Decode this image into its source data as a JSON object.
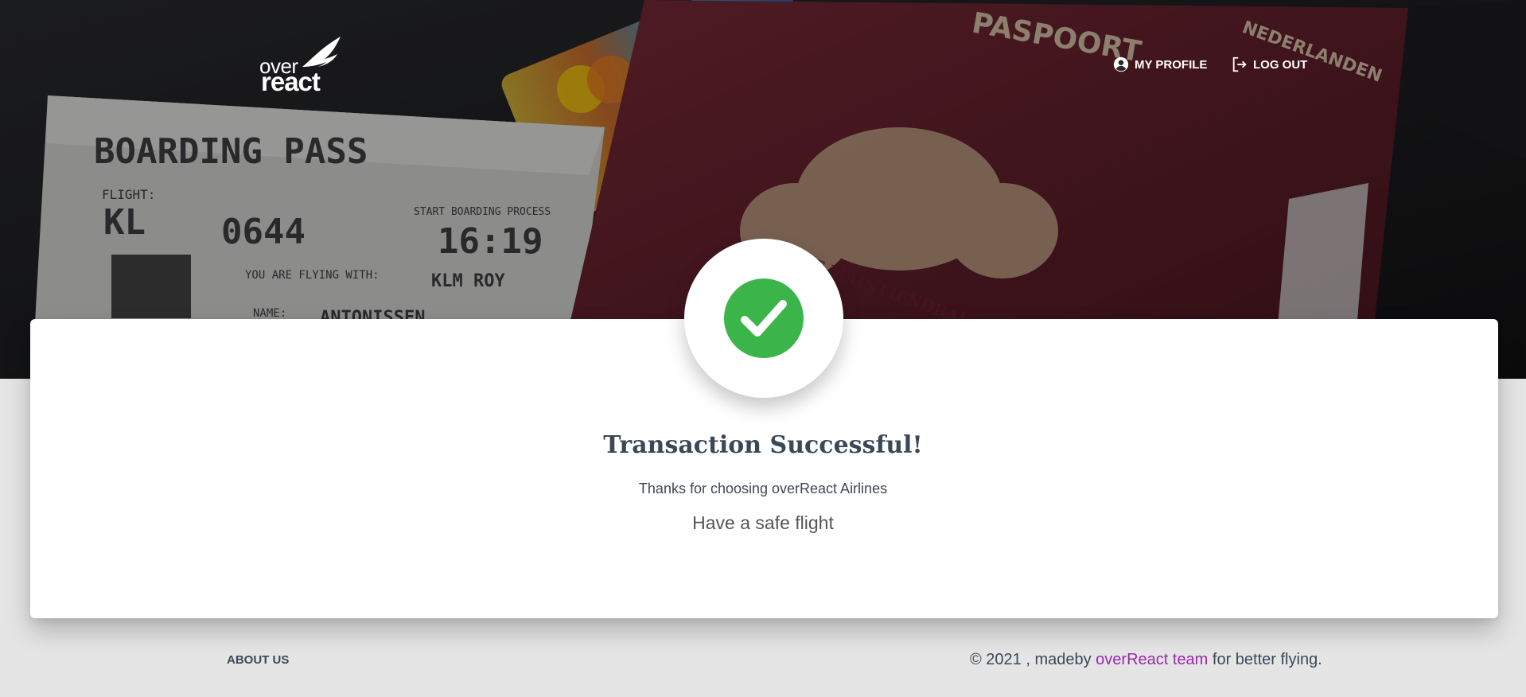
{
  "brand": {
    "logo_top": "over",
    "logo_bottom": "react"
  },
  "header": {
    "nav": [
      {
        "label": "MY PROFILE",
        "icon": "account-circle-icon"
      },
      {
        "label": "LOG OUT",
        "icon": "logout-icon"
      }
    ]
  },
  "hero": {
    "boarding_pass": {
      "heading": "BOARDING PASS",
      "flight_label": "FLIGHT:",
      "flight": "KL",
      "flight_number": "0644",
      "start_label": "START BOARDING PROCESS",
      "time": "16:19",
      "flying_with_label": "YOU ARE FLYING WITH:",
      "carrier": "KLM ROY",
      "name_label": "NAME:",
      "name": "ANTONISSEN"
    },
    "passport": {
      "text": "PASPOORT",
      "country": "NEDERLANDEN",
      "motto": "JE MAINTIENDRAI"
    }
  },
  "status": {
    "icon": "check-circle-icon",
    "title": "Transaction Successful!",
    "thanks": "Thanks for choosing overReact Airlines",
    "message": "Have a safe flight"
  },
  "footer": {
    "about_label": "ABOUT US",
    "copyright_prefix": "© 2021 , madeby ",
    "team_label": "overReact team",
    "copyright_suffix": " for better flying."
  },
  "colors": {
    "success": "#3bb54a",
    "accent": "#9c27b0",
    "text": "#3c4858"
  }
}
